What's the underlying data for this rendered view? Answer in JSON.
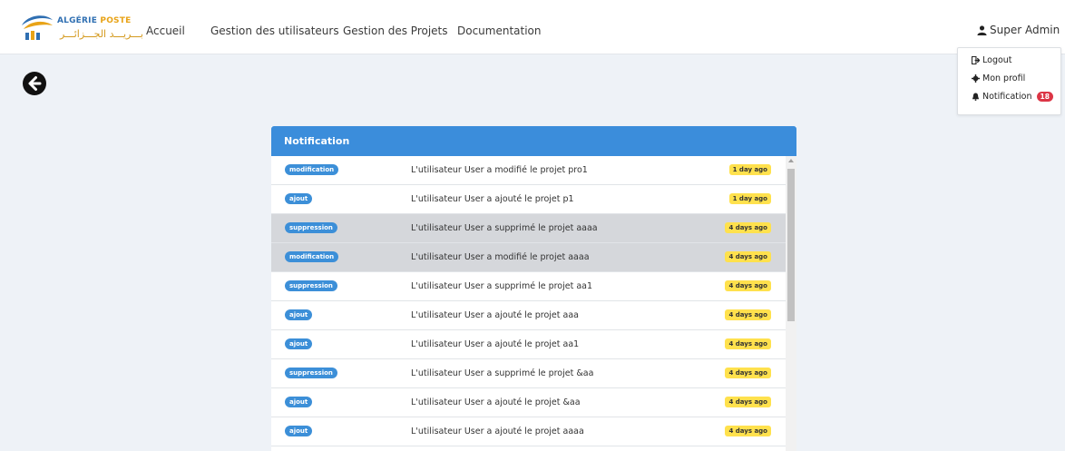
{
  "brand": {
    "name_prefix": "ALGÉRIE ",
    "name_accent": "POSTE",
    "arabic": "بـــريـــد الجـــزائـــر"
  },
  "nav": {
    "items": [
      {
        "label": "Accueil"
      },
      {
        "label": "Gestion des utilisateurs"
      },
      {
        "label": "Gestion des Projets"
      },
      {
        "label": "Documentation"
      }
    ]
  },
  "user": {
    "name": "Super Admin"
  },
  "dropdown": {
    "logout": "Logout",
    "profile": "Mon profil",
    "notification": "Notification",
    "notification_count": "18"
  },
  "panel": {
    "title": "Notification",
    "rows": [
      {
        "type": "modification",
        "message": "L'utilisateur User a modifié le projet pro1",
        "time": "1 day ago",
        "highlighted": false
      },
      {
        "type": "ajout",
        "message": "L'utilisateur User a ajouté le projet p1",
        "time": "1 day ago",
        "highlighted": false
      },
      {
        "type": "suppression",
        "message": "L'utilisateur User a supprimé le projet aaaa",
        "time": "4 days ago",
        "highlighted": true
      },
      {
        "type": "modification",
        "message": "L'utilisateur User a modifié le projet aaaa",
        "time": "4 days ago",
        "highlighted": true
      },
      {
        "type": "suppression",
        "message": "L'utilisateur User a supprimé le projet aa1",
        "time": "4 days ago",
        "highlighted": false
      },
      {
        "type": "ajout",
        "message": "L'utilisateur User a ajouté le projet aaa",
        "time": "4 days ago",
        "highlighted": false
      },
      {
        "type": "ajout",
        "message": "L'utilisateur User a ajouté le projet aa1",
        "time": "4 days ago",
        "highlighted": false
      },
      {
        "type": "suppression",
        "message": "L'utilisateur User a supprimé le projet &aa",
        "time": "4 days ago",
        "highlighted": false
      },
      {
        "type": "ajout",
        "message": "L'utilisateur User a ajouté le projet &aa",
        "time": "4 days ago",
        "highlighted": false
      },
      {
        "type": "ajout",
        "message": "L'utilisateur User a ajouté le projet aaaa",
        "time": "4 days ago",
        "highlighted": false
      }
    ]
  },
  "colors": {
    "header_blue": "#3b8ddb",
    "type_badge": "#3c8fd8",
    "time_badge": "#ffe14d",
    "notification_badge": "#dc3545",
    "highlight_row": "#d5d7db"
  },
  "icons": {
    "back": "arrow-left-circle-icon",
    "user": "user-icon",
    "caret": "caret-down-icon",
    "logout": "sign-out-icon",
    "profile": "gear-icon",
    "notification": "bell-icon"
  }
}
